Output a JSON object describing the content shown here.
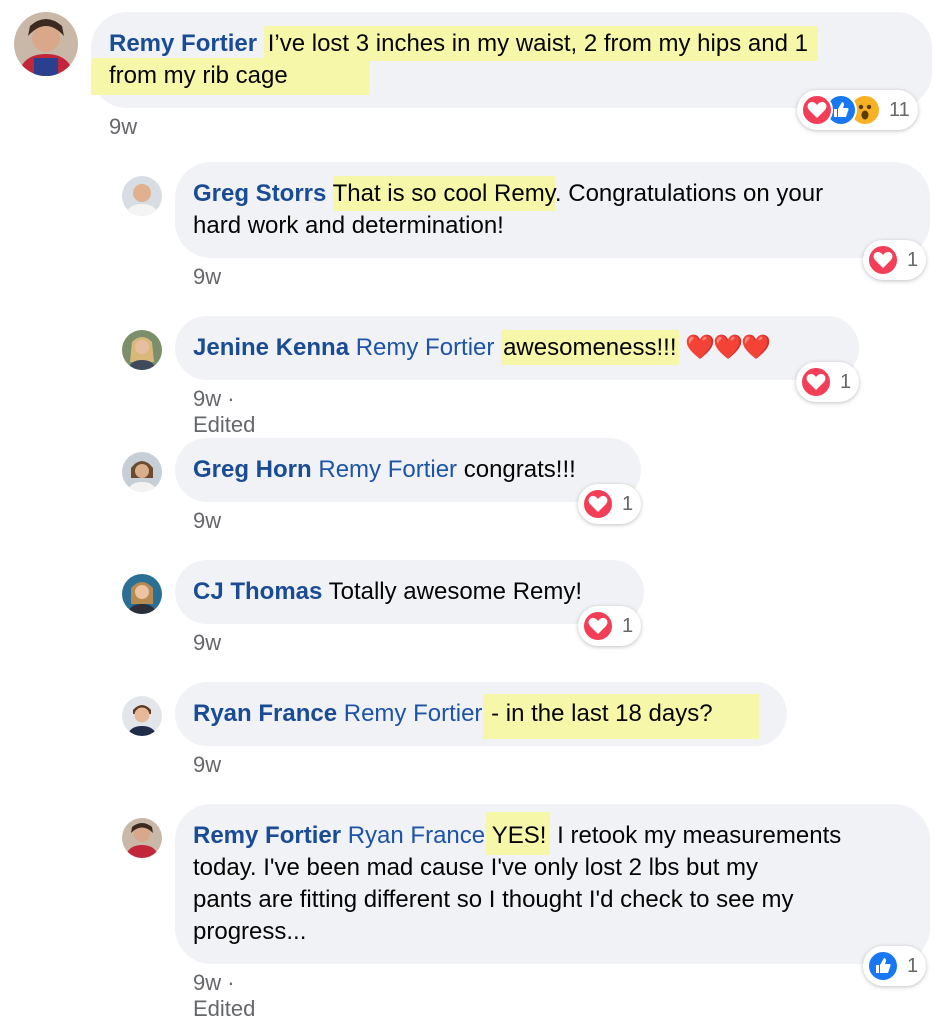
{
  "comments": [
    {
      "author": "Remy Fortier",
      "text_hl1": "I’ve lost 3 inches in my waist, 2 from my hips and 1",
      "text_hl2": "from my rib cage",
      "time": "9w",
      "reaction_count": "11"
    },
    {
      "author": "Greg Storrs",
      "text_hl": "That is so cool Remy",
      "text_a": ". Congratulations on your",
      "text_b": "hard work and determination!",
      "time": "9w",
      "reaction_count": "1"
    },
    {
      "author": "Jenine Kenna",
      "mention": "Remy Fortier",
      "text_hl": "awesomeness!!!",
      "emoji": "❤️❤️❤️",
      "time": "9w · Edited",
      "reaction_count": "1"
    },
    {
      "author": "Greg Horn",
      "mention": "Remy Fortier",
      "text": "congrats!!!",
      "time": "9w",
      "reaction_count": "1"
    },
    {
      "author": "CJ Thomas",
      "text": "Totally awesome Remy!",
      "time": "9w",
      "reaction_count": "1"
    },
    {
      "author": "Ryan France",
      "mention": "Remy Fortier",
      "text_hl": "- in the last 18 days?",
      "time": "9w"
    },
    {
      "author": "Remy Fortier",
      "mention": "Ryan France",
      "text_hl": "YES!",
      "line1": " I retook my measurements",
      "line2": "today. I've been mad cause I've only lost 2 lbs but my",
      "line3": "pants are fitting different so I thought I'd check to see my",
      "line4": "progress...",
      "time": "9w · Edited",
      "reaction_count": "1"
    }
  ],
  "colors": {
    "bubble": "#f0f2f5",
    "name": "#1a4c96",
    "highlight": "#f6f7a8",
    "love": "#f33e58",
    "like": "#1877f2",
    "meta": "#65676b"
  },
  "icons": [
    "love-icon",
    "like-icon",
    "wow-icon"
  ]
}
